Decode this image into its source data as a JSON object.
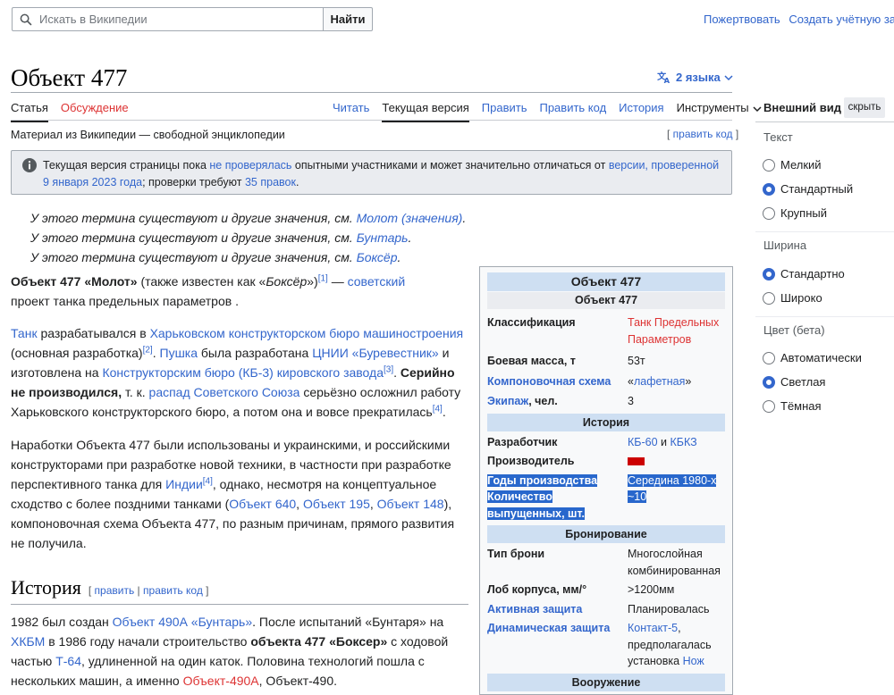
{
  "header": {
    "search_placeholder": "Искать в Википедии",
    "search_button": "Найти",
    "donate": "Пожертвовать",
    "create_account": "Создать учётную запис"
  },
  "article": {
    "title": "Объект 477",
    "languages": "2 языка",
    "tabs_left": [
      "Статья",
      "Обсуждение"
    ],
    "tabs_right": [
      "Читать",
      "Текущая версия",
      "Править",
      "Править код",
      "История",
      "Инструменты"
    ],
    "tagline": "Материал из Википедии — свободной энциклопедии",
    "edit_code": "править код",
    "notice": {
      "t1": "Текущая версия страницы пока ",
      "l1": "не проверялась",
      "t2": " опытными участниками и может значительно отличаться от ",
      "l2": "версии, проверенной 9 января 2023 года",
      "t3": "; проверки требуют ",
      "l3": "35 правок",
      "t4": "."
    },
    "hatnotes": [
      {
        "text": "У этого термина существуют и другие значения, см. ",
        "link": "Молот (значения)"
      },
      {
        "text": "У этого термина существуют и другие значения, см. ",
        "link": "Бунтарь"
      },
      {
        "text": "У этого термина существуют и другие значения, см. ",
        "link": "Боксёр"
      }
    ],
    "p1": {
      "bold": "Объект 477 «Молот»",
      "t1": " (также известен как «",
      "italic": "Боксёр",
      "t2": "»)",
      "ref1": "[1]",
      "t3": " — ",
      "l1": "советский",
      "t4": " проект танка предельных параметров ."
    },
    "p2": {
      "l1": "Танк",
      "t1": " разрабатывался в ",
      "l2": "Харьковском конструкторском бюро машиностроения",
      "t2": " (основная разработка)",
      "ref2": "[2]",
      "t3": ". ",
      "l3": "Пушка",
      "t4": " была разработана ",
      "l4": "ЦНИИ «Буревестник»",
      "t5": " и изготовлена на ",
      "l5": "Конструкторским бюро (КБ-3) кировского завода",
      "ref3": "[3]",
      "t6": ". ",
      "bold": "Серийно не производился,",
      "t7": " т. к. ",
      "l6": "распад Советского Союза",
      "t8": " серьёзно осложнил работу Харьковского конструкторского бюро, а потом она и вовсе прекратилась",
      "ref4": "[4]",
      "t9": "."
    },
    "p3": {
      "t1": "Наработки Объекта 477 были использованы и украинскими, и российскими конструкторами при разработке новой техники, в частности при разработке перспективного танка для ",
      "l1": "Индии",
      "ref": "[4]",
      "t2": ", однако, несмотря на концептуальное сходство с более поздними танками (",
      "l2": "Объект 640",
      "t3": ", ",
      "l3": "Объект 195",
      "t4": ", ",
      "l4": "Объект 148",
      "t5": "), компоновочная схема Объекта 477, по разным причинам, прямого развития не получила."
    },
    "history": {
      "heading": "История",
      "edit": "править",
      "edit_code": "править код",
      "t1": "1982 был создан ",
      "l1": "Объект 490А «Бунтарь»",
      "t2": ". После испытаний «Бунтаря» на ",
      "l2": "ХКБМ",
      "t3": " в 1986 году начали строительство ",
      "bold": "объекта 477 «Боксер»",
      "t4": " с ходовой частью ",
      "l3": "Т-64",
      "t5": ", удлиненной на один каток. Половина технологий пошла с нескольких машин, а именно ",
      "l4": "Объект-490А",
      "t6": ", Объект-490."
    }
  },
  "infobox": {
    "title": "Объект 477",
    "subtitle": "Объект 477",
    "classification_k": "Классификация",
    "classification_v": "Танк Предельных Параметров",
    "mass_k": "Боевая масса, т",
    "mass_v": "53т",
    "layout_k": "Компоновочная схема",
    "layout_v1": "«",
    "layout_link": "лафетная",
    "layout_v2": "»",
    "crew_k_link": "Экипаж",
    "crew_k_rest": ", чел.",
    "crew_v": "3",
    "history_h": "История",
    "developer_k": "Разработчик",
    "developer_l1": "КБ-60",
    "developer_and": " и ",
    "developer_l2": "КБКЗ",
    "producer_k": "Производитель",
    "years_k": "Годы производства",
    "years_v": "Середина 1980-х",
    "count_k1": "Количество",
    "count_k2": "выпущенных, шт.",
    "count_v": "~10",
    "armor_h": "Бронирование",
    "armor_type_k": "Тип брони",
    "armor_type_v": "Многослойная комбинированная",
    "hull_k": "Лоб корпуса, мм/°",
    "hull_v": ">1200мм",
    "active_k": "Активная защита",
    "active_v": "Планировалась",
    "dynamic_k": "Динамическая защита",
    "dynamic_l": "Контакт-5",
    "dynamic_v": ", предполагалась установка ",
    "dynamic_l2": "Нож",
    "weapons_h": "Вооружение"
  },
  "appearance": {
    "heading": "Внешний вид",
    "hide": "скрыть",
    "text_label": "Текст",
    "text_options": [
      "Мелкий",
      "Стандартный",
      "Крупный"
    ],
    "text_selected": "Стандартный",
    "width_label": "Ширина",
    "width_options": [
      "Стандартно",
      "Широко"
    ],
    "width_selected": "Стандартно",
    "color_label": "Цвет (бета)",
    "color_options": [
      "Автоматически",
      "Светлая",
      "Тёмная"
    ],
    "color_selected": "Светлая"
  },
  "colors": {
    "link": "#3366cc",
    "redlink": "#dd3333",
    "infobox_header": "#cedff2",
    "selection": "#2867cc"
  }
}
